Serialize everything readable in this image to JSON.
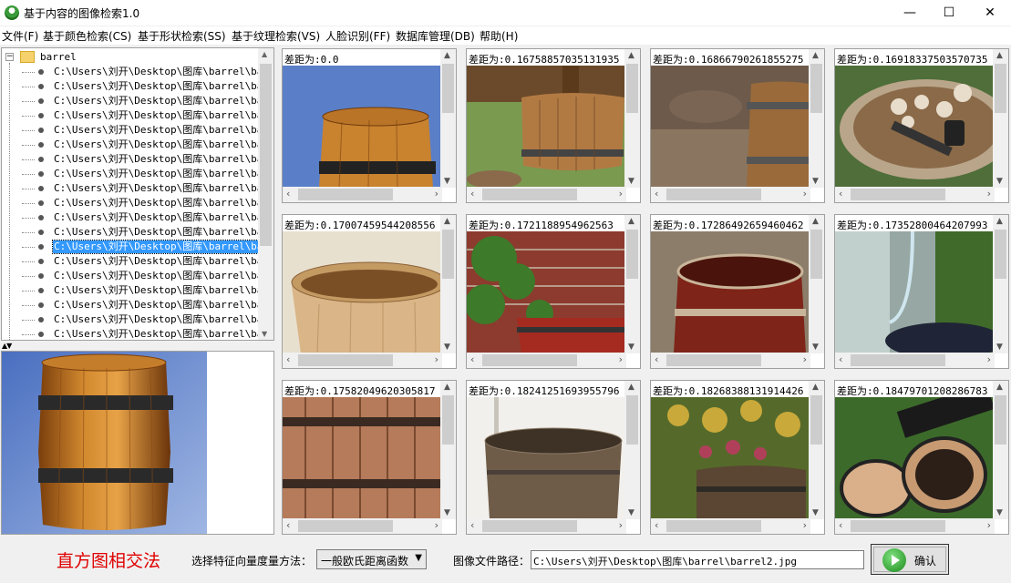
{
  "window": {
    "title": "基于内容的图像检索1.0",
    "minimize": "—",
    "maximize": "☐",
    "close": "✕"
  },
  "menu": [
    "文件(F)",
    "基于颜色检索(CS)",
    "基于形状检索(SS)",
    "基于纹理检索(VS)",
    "人脸识别(FF)",
    "数据库管理(DB)",
    "帮助(H)"
  ],
  "tree": {
    "root": "barrel",
    "expander": "−",
    "items": [
      "C:\\Users\\刘开\\Desktop\\图库\\barrel\\barr",
      "C:\\Users\\刘开\\Desktop\\图库\\barrel\\barr",
      "C:\\Users\\刘开\\Desktop\\图库\\barrel\\barr",
      "C:\\Users\\刘开\\Desktop\\图库\\barrel\\barr",
      "C:\\Users\\刘开\\Desktop\\图库\\barrel\\barr",
      "C:\\Users\\刘开\\Desktop\\图库\\barrel\\barr",
      "C:\\Users\\刘开\\Desktop\\图库\\barrel\\barr",
      "C:\\Users\\刘开\\Desktop\\图库\\barrel\\barr",
      "C:\\Users\\刘开\\Desktop\\图库\\barrel\\barr",
      "C:\\Users\\刘开\\Desktop\\图库\\barrel\\barr",
      "C:\\Users\\刘开\\Desktop\\图库\\barrel\\barr",
      "C:\\Users\\刘开\\Desktop\\图库\\barrel\\barr",
      "C:\\Users\\刘开\\Desktop\\图库\\barrel\\barr",
      "C:\\Users\\刘开\\Desktop\\图库\\barrel\\barr",
      "C:\\Users\\刘开\\Desktop\\图库\\barrel\\barr",
      "C:\\Users\\刘开\\Desktop\\图库\\barrel\\barr",
      "C:\\Users\\刘开\\Desktop\\图库\\barrel\\barr",
      "C:\\Users\\刘开\\Desktop\\图库\\barrel\\barr",
      "C:\\Users\\刘开\\Desktop\\图库\\barrel\\barr"
    ],
    "selected_index": 12
  },
  "splitter": "▲▼",
  "results": [
    {
      "label": "差距为:0.0",
      "scene": "barrel-blue"
    },
    {
      "label": "差距为:0.16758857035131935",
      "scene": "tub-garden"
    },
    {
      "label": "差距为:0.16866790261855275",
      "scene": "barrel-log"
    },
    {
      "label": "差距为:0.16918337503570735",
      "scene": "barrel-tools"
    },
    {
      "label": "差距为:0.17007459544208556",
      "scene": "bucket-close"
    },
    {
      "label": "差距为:0.1721188954962563",
      "scene": "planter-brick"
    },
    {
      "label": "差距为:0.17286492659460462",
      "scene": "barrel-red"
    },
    {
      "label": "差距为:0.17352800464207993",
      "scene": "barrel-hose"
    },
    {
      "label": "差距为:0.17582049620305817",
      "scene": "barrel-closeup"
    },
    {
      "label": "差距为:0.18241251693955796",
      "scene": "tub-old"
    },
    {
      "label": "差距为:0.18268388131914426",
      "scene": "planter-flowers"
    },
    {
      "label": "差距为:0.18479701208286783",
      "scene": "barrels-pile"
    }
  ],
  "bottom": {
    "method": "直方图相交法",
    "select_label": "选择特征向量度量方法：",
    "select_value": "一般欧氏距离函数",
    "path_label": "图像文件路径：",
    "path_value": "C:\\Users\\刘开\\Desktop\\图库\\barrel\\barrel2.jpg",
    "ok_label": "确认"
  },
  "icons": {
    "app": "app-logo-icon",
    "ok": "play-icon"
  }
}
